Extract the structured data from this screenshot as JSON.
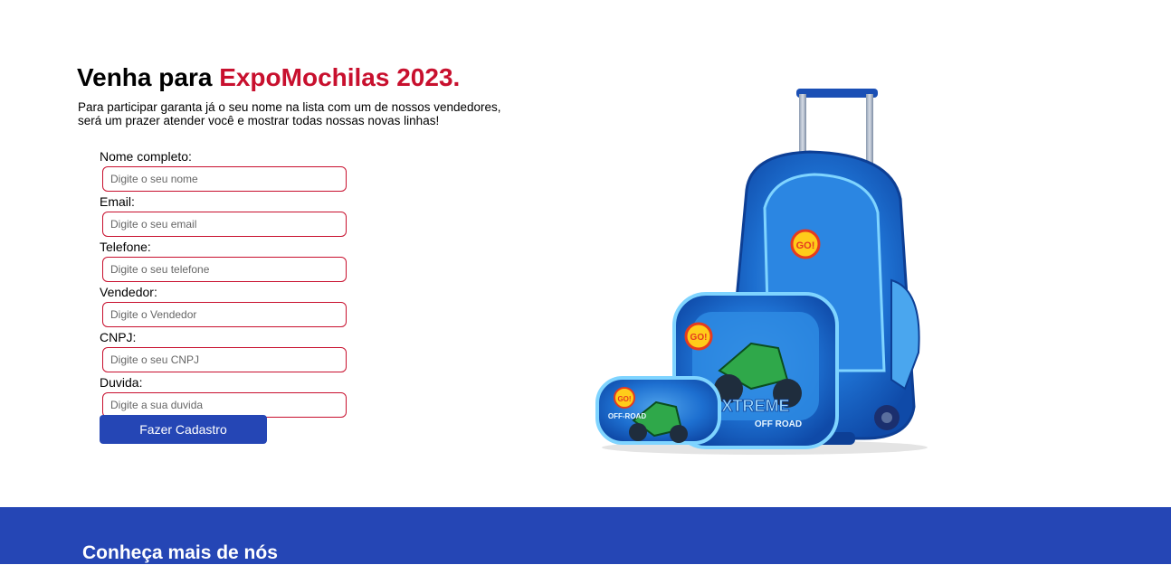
{
  "hero": {
    "title_prefix": "Venha para ",
    "title_accent": "ExpoMochilas 2023.",
    "intro_line1": "Para participar garanta já o seu nome na lista com um de nossos vendedores,",
    "intro_line2": "será um prazer atender você e mostrar todas nossas novas linhas!"
  },
  "form": {
    "fields": [
      {
        "label": "Nome completo:",
        "placeholder": "Digite o seu nome"
      },
      {
        "label": "Email:",
        "placeholder": "Digite o seu email"
      },
      {
        "label": "Telefone:",
        "placeholder": "Digite o seu telefone"
      },
      {
        "label": "Vendedor:",
        "placeholder": "Digite o Vendedor"
      },
      {
        "label": "CNPJ:",
        "placeholder": "Digite o seu CNPJ"
      },
      {
        "label": "Duvida:",
        "placeholder": "Digite a sua duvida"
      }
    ],
    "submit_label": "Fazer Cadastro"
  },
  "product": {
    "badge1": "GO!",
    "badge2": "GO!",
    "badge3": "GO!",
    "text1": "XTREME",
    "text2": "OFF ROAD",
    "text3": "OFF-ROAD"
  },
  "footer": {
    "title": "Conheça mais de nós"
  },
  "colors": {
    "accent_red": "#c8102e",
    "brand_blue": "#2546b5"
  }
}
